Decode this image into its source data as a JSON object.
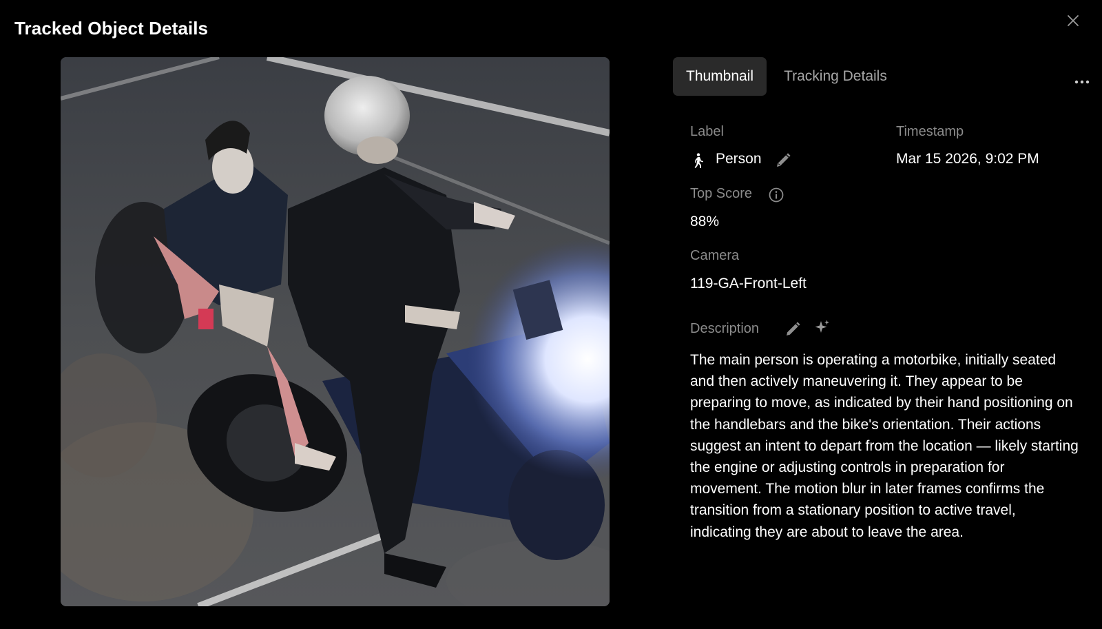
{
  "dialog": {
    "title": "Tracked Object Details"
  },
  "tabs": [
    {
      "label": "Thumbnail",
      "active": true
    },
    {
      "label": "Tracking Details",
      "active": false
    }
  ],
  "details": {
    "label": {
      "heading": "Label",
      "value": "Person",
      "icon": "person-walking-icon"
    },
    "timestamp": {
      "heading": "Timestamp",
      "value": "Mar 15 2026, 9:02 PM"
    },
    "top_score": {
      "heading": "Top Score",
      "value": "88%"
    },
    "camera": {
      "heading": "Camera",
      "value": "119-GA-Front-Left"
    },
    "description": {
      "heading": "Description",
      "text": "The main person is operating a motorbike, initially seated and then actively maneuvering it. They appear to be preparing to move, as indicated by their hand positioning on the handlebars and the bike's orientation. Their actions suggest an intent to depart from the location — likely starting the engine or adjusting controls in preparation for movement. The motion blur in later frames confirms the transition from a stationary position to active travel, indicating they are about to leave the area."
    }
  },
  "colors": {
    "background": "#000000",
    "tab_active_bg": "#2a2a2a",
    "label_gray": "#8b8b8b",
    "text": "#ffffff"
  }
}
